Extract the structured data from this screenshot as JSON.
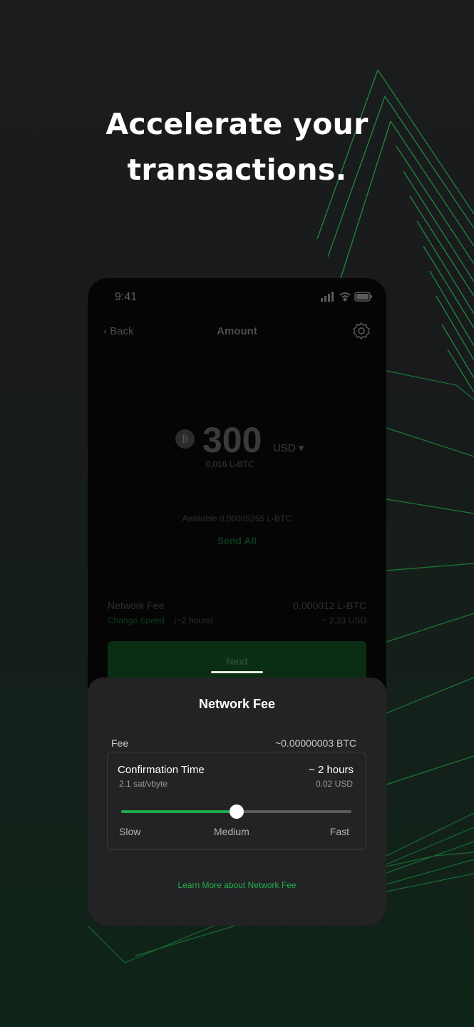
{
  "headline": {
    "line1": "Accelerate your",
    "line2": "transactions."
  },
  "phone": {
    "status": {
      "time": "9:41",
      "icons": [
        "signal-icon",
        "wifi-icon",
        "battery-icon"
      ]
    },
    "nav": {
      "back": "Back",
      "title": "Amount",
      "settings_icon": "gear-icon"
    },
    "amount": {
      "currency_icon": "bitcoin-icon",
      "value": "300",
      "currency": "USD",
      "converted": "0,016 L-BTC",
      "available": "Available 0.00005265 L-BTC",
      "send_all": "Send All"
    },
    "network_fee": {
      "label": "Network Fee",
      "value": "0.000012 L-BTC",
      "change_speed": "Change Speed",
      "time": "(~2 hours)",
      "usd": "~ 2,23 USD"
    },
    "next_button": "Next"
  },
  "sheet": {
    "title": "Network Fee",
    "fee_label": "Fee",
    "fee_value": "~0.00000003 BTC",
    "confirmation": {
      "title": "Confirmation Time",
      "rate": "2.1 sat/vbyte",
      "time": "~ 2 hours",
      "usd": "0.02 USD"
    },
    "slider": {
      "value_fraction": 0.5,
      "labels": {
        "slow": "Slow",
        "medium": "Medium",
        "fast": "Fast"
      }
    },
    "learn_more": "Learn More about Network Fee"
  },
  "colors": {
    "accent": "#1faa47",
    "sheet_bg": "#232325",
    "phone_bg": "#050505"
  }
}
